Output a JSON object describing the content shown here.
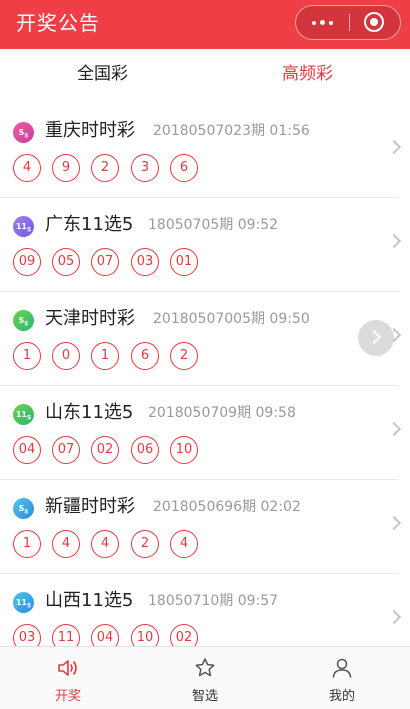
{
  "header": {
    "title": "开奖公告"
  },
  "tabs": [
    {
      "label": "全国彩",
      "active": false
    },
    {
      "label": "高频彩",
      "active": true
    }
  ],
  "accent_color": "#e5393f",
  "header_color": "#ef3e45",
  "lotteries": [
    {
      "name": "重庆时时彩",
      "draw": "20180507023期 01:56",
      "icon": "ssc-badge-icon",
      "balls": [
        "4",
        "9",
        "2",
        "3",
        "6"
      ]
    },
    {
      "name": "广东11选5",
      "draw": "18050705期 09:52",
      "icon": "11x5-badge-icon",
      "balls": [
        "09",
        "05",
        "07",
        "03",
        "01"
      ]
    },
    {
      "name": "天津时时彩",
      "draw": "20180507005期 09:50",
      "icon": "ssc-badge-icon",
      "balls": [
        "1",
        "0",
        "1",
        "6",
        "2"
      ]
    },
    {
      "name": "山东11选5",
      "draw": "2018050709期 09:58",
      "icon": "11x5-badge-icon",
      "balls": [
        "04",
        "07",
        "02",
        "06",
        "10"
      ]
    },
    {
      "name": "新疆时时彩",
      "draw": "2018050696期 02:02",
      "icon": "ssc-badge-icon",
      "balls": [
        "1",
        "4",
        "4",
        "2",
        "4"
      ]
    },
    {
      "name": "山西11选5",
      "draw": "18050710期 09:57",
      "icon": "11x5-badge-icon",
      "balls": [
        "03",
        "11",
        "04",
        "10",
        "02"
      ]
    }
  ],
  "tabbar": [
    {
      "label": "开奖",
      "icon": "speaker-icon",
      "active": true
    },
    {
      "label": "智选",
      "icon": "star-icon",
      "active": false
    },
    {
      "label": "我的",
      "icon": "person-icon",
      "active": false
    }
  ]
}
